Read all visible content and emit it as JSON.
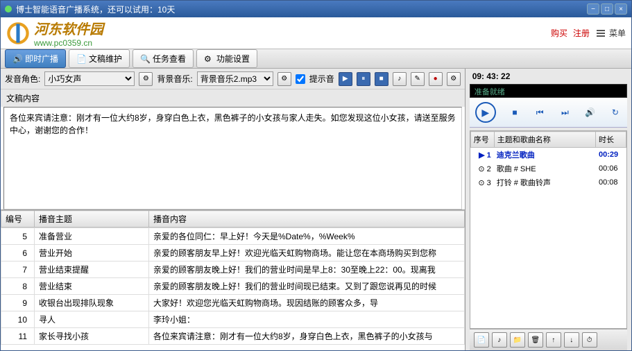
{
  "window": {
    "title": "博士智能语音广播系统，还可以试用：10天"
  },
  "logo": {
    "text": "河东软件园",
    "sub": "www.pc0359.cn"
  },
  "links": {
    "buy": "购买",
    "register": "注册",
    "menu": "菜单"
  },
  "tabs": [
    {
      "label": "即时广播",
      "active": true
    },
    {
      "label": "文稿维护",
      "active": false
    },
    {
      "label": "任务查看",
      "active": false
    },
    {
      "label": "功能设置",
      "active": false
    }
  ],
  "controls": {
    "voice_label": "发音角色:",
    "voice_value": "小巧女声",
    "bgm_label": "背景音乐:",
    "bgm_value": "背景音乐2.mp3",
    "hint_label": "提示音"
  },
  "script": {
    "label": "文稿内容",
    "text": "各位来宾请注意：刚才有一位大约8岁，身穿白色上衣，黑色裤子的小女孩与家人走失。如您发现这位小女孩，请送至服务中心，谢谢您的合作！"
  },
  "table": {
    "headers": [
      "编号",
      "播音主题",
      "播音内容"
    ],
    "rows": [
      {
        "id": "5",
        "topic": "准备营业",
        "content": "亲爱的各位同仁：早上好！今天是%Date%，%Week%"
      },
      {
        "id": "6",
        "topic": "营业开始",
        "content": "亲爱的顾客朋友早上好！欢迎光临天虹购物商场。能让您在本商场购买到您称"
      },
      {
        "id": "7",
        "topic": "营业结束提醒",
        "content": "亲爱的顾客朋友晚上好！我们的营业时间是早上8：30至晚上22：00。现离我"
      },
      {
        "id": "8",
        "topic": "营业结束",
        "content": "亲爱的顾客朋友晚上好！我们的营业时间现已结束。又到了跟您说再见的时候"
      },
      {
        "id": "9",
        "topic": "收银台出现排队现象",
        "content": "大家好！欢迎您光临天虹购物商场。现因结账的顾客众多，导"
      },
      {
        "id": "10",
        "topic": "寻人",
        "content": "李玲小姐："
      },
      {
        "id": "11",
        "topic": "家长寻找小孩",
        "content": "各位来宾请注意：刚才有一位大约8岁，身穿白色上衣，黑色裤子的小女孩与"
      }
    ]
  },
  "clock": "09: 43: 22",
  "player": {
    "status": "准备就绪"
  },
  "playlist": {
    "headers": [
      "序号",
      "主题和歌曲名称",
      "时长"
    ],
    "rows": [
      {
        "no": "1",
        "name": "迪克兰歌曲",
        "dur": "00:29",
        "sel": true
      },
      {
        "no": "2",
        "name": "歌曲 # SHE",
        "dur": "00:06",
        "sel": false
      },
      {
        "no": "3",
        "name": "打铃 # 歌曲铃声",
        "dur": "00:08",
        "sel": false
      }
    ]
  }
}
